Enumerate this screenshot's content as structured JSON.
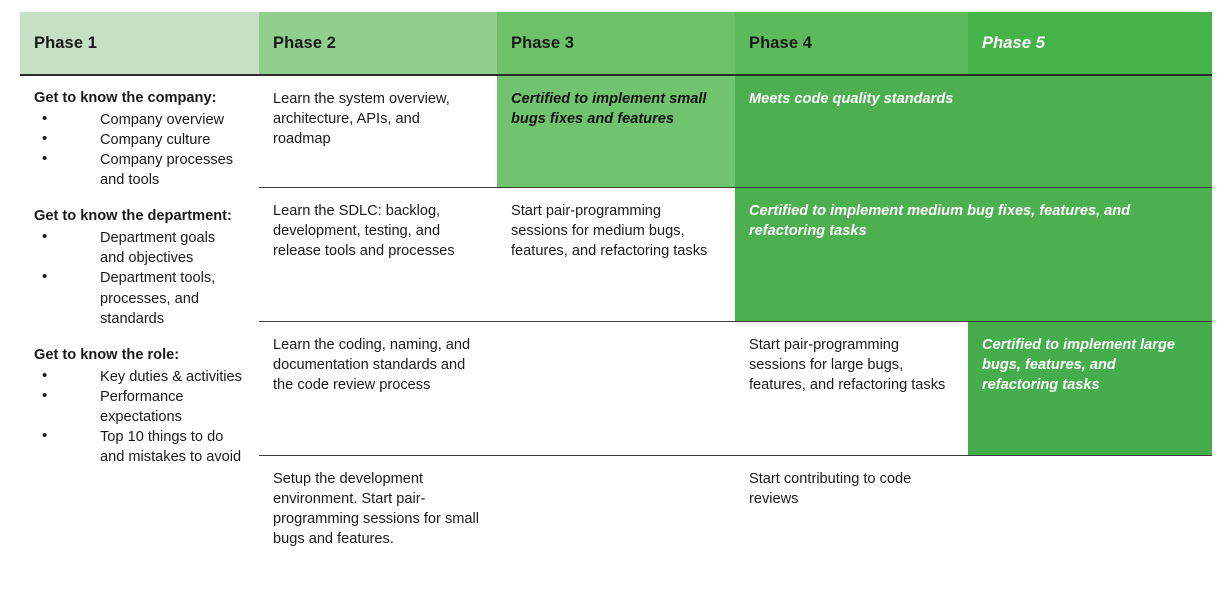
{
  "document": {
    "type": "onboarding-phase-roadmap-table"
  },
  "colors": {
    "phase1_header": "#c5e0c4",
    "phase2_header": "#92cf8e",
    "phase3_header": "#6dc269",
    "phase4_header": "#5cba5a",
    "phase5_header": "#45b24a",
    "certified_mid": "#71c46e",
    "certified_strong": "#4caf50",
    "border": "#2b2b2b",
    "text": "#1a1a1a",
    "text_inverse": "#ffffff"
  },
  "headers": [
    {
      "label": "Phase 1",
      "style": "bold"
    },
    {
      "label": "Phase 2",
      "style": "bold"
    },
    {
      "label": "Phase 3",
      "style": "bold"
    },
    {
      "label": "Phase 4",
      "style": "bold"
    },
    {
      "label": "Phase 5",
      "style": "bold-italic-white"
    }
  ],
  "phase1": {
    "groups": [
      {
        "title": "Get to know the company:",
        "items": [
          "Company overview",
          "Company culture",
          "Company processes and tools"
        ]
      },
      {
        "title": "Get to know the department:",
        "items": [
          "Department goals and objectives",
          "Department tools, processes, and standards"
        ]
      },
      {
        "title": "Get to know the role:",
        "items": [
          "Key duties & activities",
          "Performance expectations",
          "Top 10 things to do and mistakes to avoid"
        ]
      }
    ]
  },
  "rows": [
    {
      "phase2": "Learn the system overview, architecture, APIs, and roadmap",
      "phase3": "Certified to implement small bugs fixes and features",
      "phase45": "Meets code quality standards"
    },
    {
      "phase2": "Learn the SDLC: backlog, development, testing, and release tools and processes",
      "phase3": "Start pair-programming sessions for medium bugs, features, and refactoring tasks",
      "phase45": "Certified to implement medium bug fixes, features, and refactoring tasks"
    },
    {
      "phase2": "Learn the coding, naming, and documentation standards and the code review process",
      "phase3": "",
      "phase4": "Start pair-programming sessions for large bugs, features, and refactoring tasks",
      "phase5": "Certified to implement large bugs, features, and refactoring tasks"
    },
    {
      "phase2": "Setup the development environment. Start pair-programming sessions for small bugs and features.",
      "phase3": "",
      "phase4": "Start contributing to code reviews",
      "phase5": ""
    }
  ]
}
